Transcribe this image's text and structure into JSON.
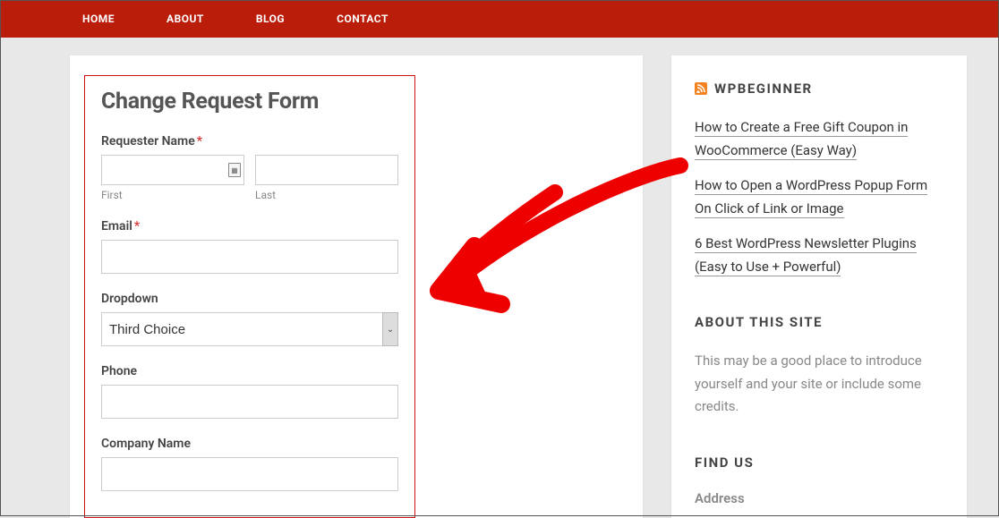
{
  "nav": {
    "items": [
      "HOME",
      "ABOUT",
      "BLOG",
      "CONTACT"
    ]
  },
  "form": {
    "title": "Change Request Form",
    "requester_label": "Requester Name",
    "first_sub": "First",
    "last_sub": "Last",
    "email_label": "Email",
    "dropdown_label": "Dropdown",
    "dropdown_value": "Third Choice",
    "phone_label": "Phone",
    "company_label": "Company Name",
    "asterisk": "*"
  },
  "sidebar": {
    "feed_title": "WPBEGINNER",
    "links": [
      "How to Create a Free Gift Coupon in WooCommerce (Easy Way)",
      "How to Open a WordPress Popup Form On Click of Link or Image",
      "6 Best WordPress Newsletter Plugins (Easy to Use + Powerful)"
    ],
    "about_title": "ABOUT THIS SITE",
    "about_text": "This may be a good place to introduce yourself and your site or include some credits.",
    "findus_title": "FIND US",
    "address_label": "Address"
  }
}
